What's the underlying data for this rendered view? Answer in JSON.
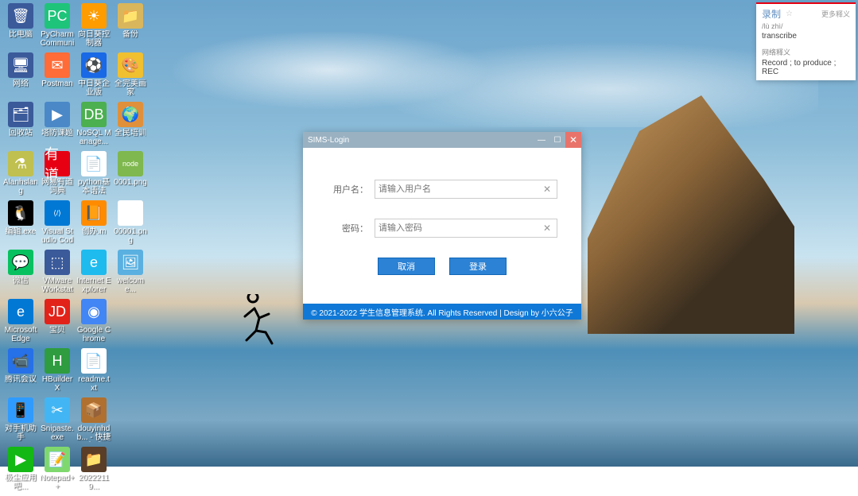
{
  "desktop_icons": [
    {
      "name": "比电脑",
      "color": "#3a5a9a",
      "glyph": "🗑"
    },
    {
      "name": "PyCharm Communit...",
      "color": "#1ec47a",
      "glyph": "PC"
    },
    {
      "name": "向日葵控制器",
      "color": "#ff9c00",
      "glyph": "☀"
    },
    {
      "name": "备份",
      "color": "#d9b65c",
      "glyph": "📁"
    },
    {
      "name": "网络",
      "color": "#3a5a9a",
      "glyph": "🖥"
    },
    {
      "name": "Postman",
      "color": "#ff6c37",
      "glyph": "✉"
    },
    {
      "name": "中日葵企业版",
      "color": "#1968e6",
      "glyph": "⚽"
    },
    {
      "name": "全完美画家",
      "color": "#f0c030",
      "glyph": "🎨"
    },
    {
      "name": "回收站",
      "color": "#3a5a9a",
      "glyph": "🗂"
    },
    {
      "name": "塔防课题",
      "color": "#4a88c8",
      "glyph": "▶"
    },
    {
      "name": "NoSQL Manage...",
      "color": "#4caf50",
      "glyph": "DB"
    },
    {
      "name": "全民培训",
      "color": "#e0903a",
      "glyph": "🌍"
    },
    {
      "name": "Alanhslang",
      "color": "#c0c050",
      "glyph": "⚗"
    },
    {
      "name": "网易有道词典",
      "color": "#e60012",
      "glyph": "有道"
    },
    {
      "name": "python基本语法",
      "color": "#fff",
      "glyph": "📄"
    },
    {
      "name": "0001.png",
      "color": "#7fb84e",
      "glyph": "node"
    },
    {
      "name": "编辑.exe",
      "color": "#000",
      "glyph": "🐧"
    },
    {
      "name": "Visual Studio Code",
      "color": "#0078d4",
      "glyph": "⟨/⟩"
    },
    {
      "name": "创办.m",
      "color": "#ff8c00",
      "glyph": "📙"
    },
    {
      "name": "00001.png",
      "color": "#fff",
      "glyph": "🖼"
    },
    {
      "name": "微信",
      "color": "#07c160",
      "glyph": "💬"
    },
    {
      "name": "VMware Workstati...",
      "color": "#3a5a9a",
      "glyph": "⬚"
    },
    {
      "name": "Internet Explorer",
      "color": "#1ebbee",
      "glyph": "e"
    },
    {
      "name": "welcome...",
      "color": "#5ab0e0",
      "glyph": "🖼"
    },
    {
      "name": "Microsoft Edge",
      "color": "#0078d4",
      "glyph": "e"
    },
    {
      "name": "宝贝",
      "color": "#e2231a",
      "glyph": "JD"
    },
    {
      "name": "Google Chrome",
      "color": "#4285f4",
      "glyph": "◉"
    },
    {
      "name": "",
      "color": "transparent",
      "glyph": ""
    },
    {
      "name": "腾讯会议",
      "color": "#2670e8",
      "glyph": "📹"
    },
    {
      "name": "HBuilder X",
      "color": "#2e9c3f",
      "glyph": "H"
    },
    {
      "name": "readme.txt",
      "color": "#fff",
      "glyph": "📄"
    },
    {
      "name": "",
      "color": "transparent",
      "glyph": ""
    },
    {
      "name": "对手机助手",
      "color": "#2f9bff",
      "glyph": "📱"
    },
    {
      "name": "Snipaste.exe",
      "color": "#42b6f4",
      "glyph": "✂"
    },
    {
      "name": "douyinhdb... - 快捷方式",
      "color": "#b07030",
      "glyph": "📦"
    },
    {
      "name": "",
      "color": "transparent",
      "glyph": ""
    },
    {
      "name": "极尘应用吧...",
      "color": "#14b814",
      "glyph": "▶"
    },
    {
      "name": "Notepad++",
      "color": "#7fd86e",
      "glyph": "📝"
    },
    {
      "name": "20222119...",
      "color": "#5a3e28",
      "glyph": "📁"
    }
  ],
  "login_window": {
    "title": "SIMS-Login",
    "username_label": "用户名：",
    "username_placeholder": "请输入用户名",
    "password_label": "密码：",
    "password_placeholder": "请输入密码",
    "cancel_label": "取消",
    "login_label": "登录",
    "footer_text": "© 2021-2022 学生信息管理系统. All Rights Reserved | Design by 小六公子"
  },
  "dict_popup": {
    "word": "录制",
    "more": "更多释义",
    "pronunciation": "/lù zhì/",
    "definition": "transcribe",
    "section_label": "网络释义",
    "network_def": "Record ; to produce ; REC"
  }
}
